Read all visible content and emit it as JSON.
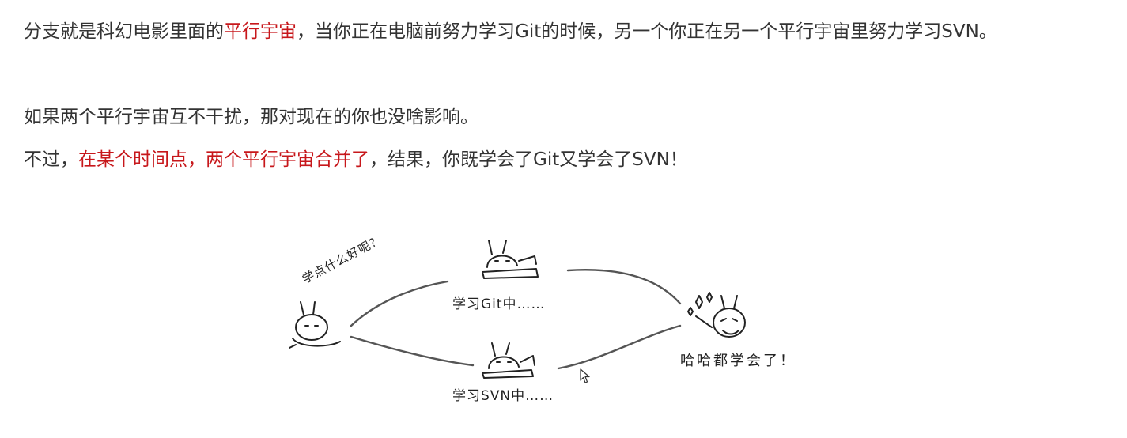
{
  "paragraphs": {
    "p1": {
      "before": "分支就是科幻电影里面的",
      "highlight": "平行宇宙",
      "after": "，当你正在电脑前努力学习Git的时候，另一个你正在另一个平行宇宙里努力学习SVN。"
    },
    "p2": {
      "text": "如果两个平行宇宙互不干扰，那对现在的你也没啥影响。"
    },
    "p3": {
      "before": "不过，",
      "highlight": "在某个时间点，两个平行宇宙合并了",
      "after": "，结果，你既学会了Git又学会了SVN！"
    }
  },
  "figure": {
    "question": "学点什么好呢?",
    "git_branch": "学习Git中……",
    "svn_branch": "学习SVN中……",
    "merged": "哈哈都学会了！"
  },
  "colors": {
    "text": "#333333",
    "highlight": "#c7171b"
  }
}
